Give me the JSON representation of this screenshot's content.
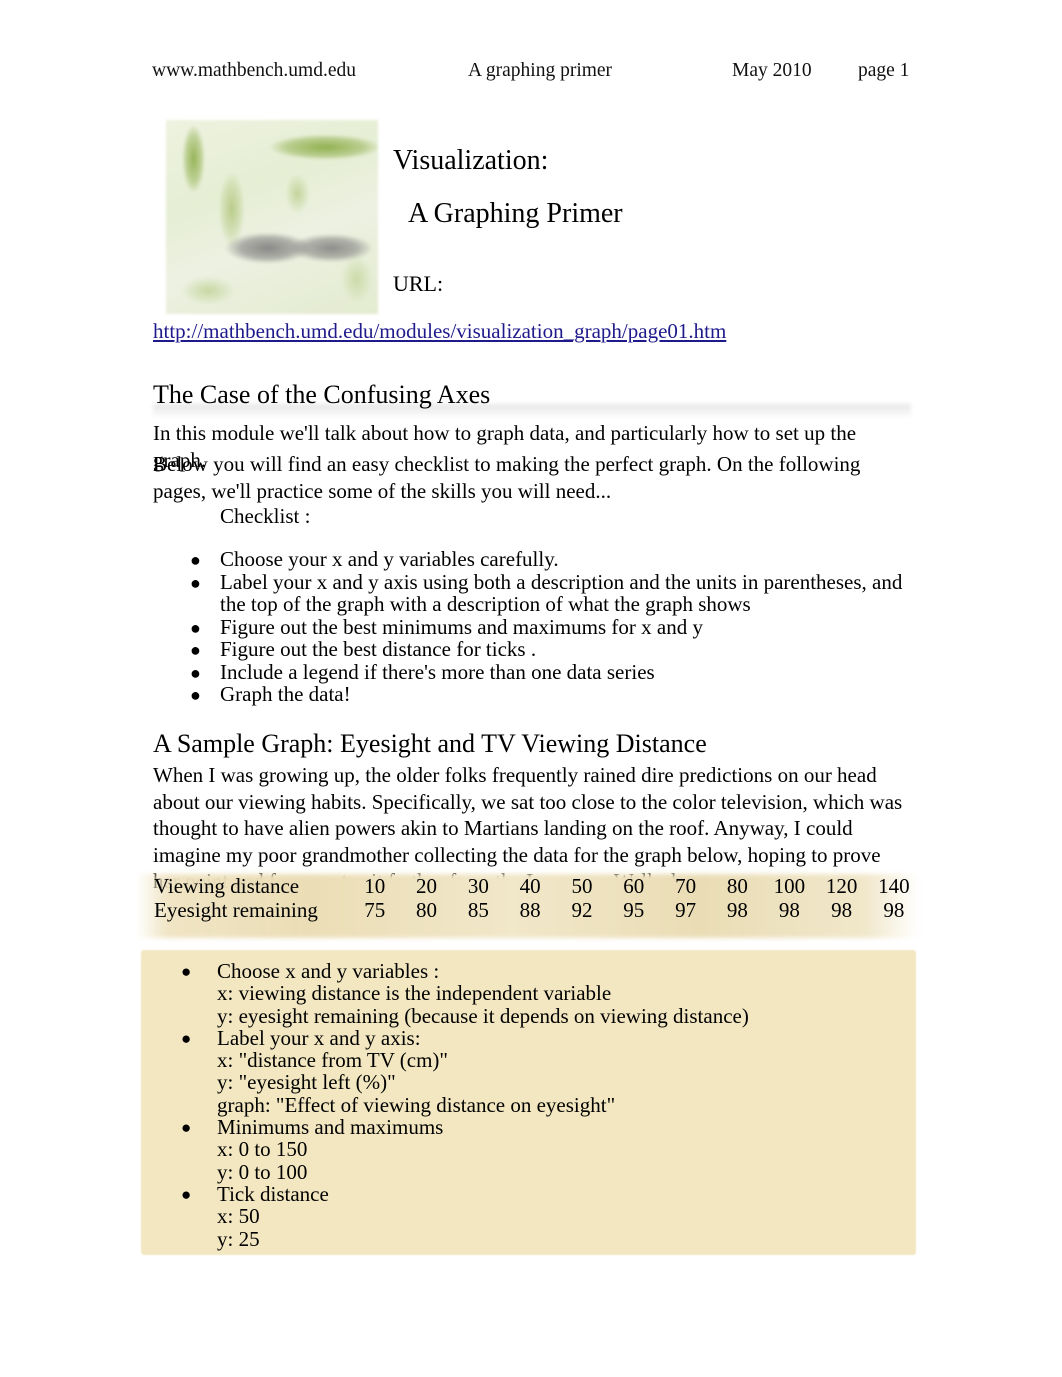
{
  "header": {
    "site": "www.mathbench.umd.edu",
    "doc_title": "A graphing primer",
    "date": "May 2010",
    "page": "page 1"
  },
  "title": {
    "line1": "Visualization:",
    "line2": "A Graphing Primer",
    "url_label": "URL:",
    "url": "http://mathbench.umd.edu/modules/visualization_graph/page01.htm"
  },
  "logo": {
    "alt": "mathbench-logo"
  },
  "section1": {
    "heading": "The Case of the Confusing Axes",
    "para1": "In this module we'll talk about how to graph data, and particularly how to set up the graph.",
    "para2": "Below you will find an easy checklist to making the perfect graph. On the following pages, we'll practice some of the skills you will need...",
    "checklist_label": "Checklist :",
    "bullet_glyph": "●",
    "checklist": [
      "Choose your x and y   variables carefully.",
      "Label  your x and y axis using both a description and the units in parentheses, and the top of the graph with a description of what the graph shows",
      "Figure out the best minimums and maximums    for x and y",
      "Figure out the best distance for ticks  .",
      "Include a legend if there's more than one data series",
      "Graph  the data!"
    ]
  },
  "section2": {
    "heading": "A Sample Graph: Eyesight and TV Viewing Distance",
    "para1": "When I was growing up, the older folks frequently rained dire predictions on our head about our viewing habits. Specifically, we sat too close to the color television, which was thought to have alien powers akin to Martians landing on the roof. Anyway, I could imagine my poor grandmother collecting the data for the graph below, hoping to prove her point and force us to sit farther from the Lawrence Welk show:"
  },
  "chart_data": {
    "type": "table",
    "title": "Eyesight and TV Viewing Distance",
    "rows": [
      {
        "label": "Viewing distance",
        "values": [
          "10",
          "20",
          "30",
          "40",
          "50",
          "60",
          "70",
          "80",
          "100",
          "120",
          "140"
        ]
      },
      {
        "label": "Eyesight remaining",
        "values": [
          "75",
          "80",
          "85",
          "88",
          "92",
          "95",
          "97",
          "98",
          "98",
          "98",
          "98"
        ]
      }
    ],
    "x": [
      10,
      20,
      30,
      40,
      50,
      60,
      70,
      80,
      100,
      120,
      140
    ],
    "y": [
      75,
      80,
      85,
      88,
      92,
      95,
      97,
      98,
      98,
      98,
      98
    ],
    "xlabel": "distance from TV (cm)",
    "ylabel": "eyesight left (%)",
    "xlim": [
      0,
      150
    ],
    "ylim": [
      0,
      100
    ],
    "xtick_step": 50,
    "ytick_step": 25
  },
  "answer_box": {
    "bullet_glyph": "●",
    "items": [
      {
        "head": "Choose x and y variables  :",
        "subs": [
          "x: viewing distance is the independent variable",
          "y: eyesight remaining (because it depends on viewing distance)"
        ]
      },
      {
        "head": "Label  your x and y axis:",
        "subs": [
          "x: \"distance from TV (cm)\"",
          "y: \"eyesight left (%)\"",
          "graph: \"Effect of viewing distance on eyesight\""
        ]
      },
      {
        "head": "Minimums and maximums",
        "subs": [
          "x: 0 to 150",
          "y: 0 to 100"
        ]
      },
      {
        "head": "Tick distance",
        "subs": [
          "x: 50",
          "y: 25"
        ]
      }
    ]
  },
  "colors": {
    "link": "#1f1a8c",
    "answer_box_bg": "#f2e7c0",
    "table_bg": "#ebdeb6",
    "text": "#000000"
  }
}
